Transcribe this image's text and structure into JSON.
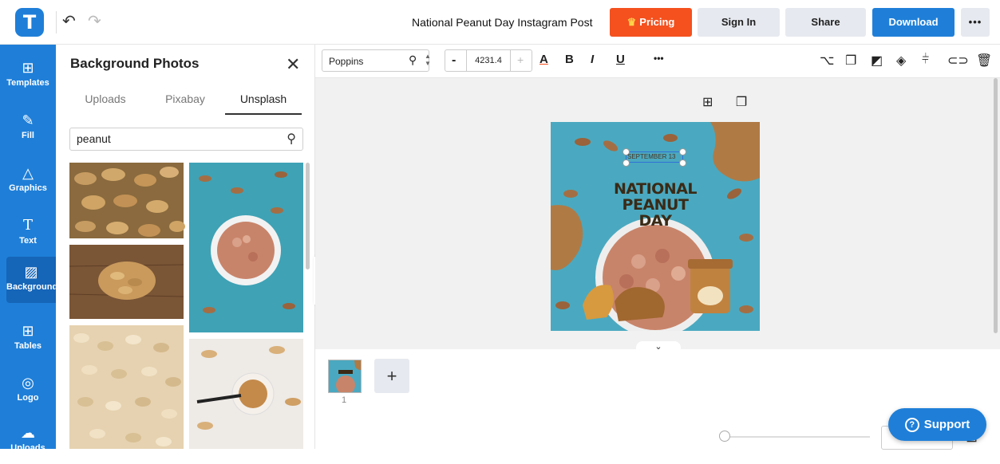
{
  "header": {
    "logo_letter": "T",
    "undo_icon": "undo-icon",
    "redo_icon": "redo-icon",
    "document_title": "National Peanut Day Instagram Post",
    "pricing_label": "Pricing",
    "signin_label": "Sign In",
    "share_label": "Share",
    "download_label": "Download",
    "more_label": "•••",
    "colors": {
      "brand": "#1f7fd8",
      "pricing": "#f4511e",
      "neutral_button": "#e6e9ef"
    }
  },
  "rail": {
    "items": [
      {
        "label": "Templates",
        "icon": "templates-icon"
      },
      {
        "label": "Fill",
        "icon": "fill-icon"
      },
      {
        "label": "Graphics",
        "icon": "graphics-icon"
      },
      {
        "label": "Text",
        "icon": "text-icon"
      },
      {
        "label": "Background",
        "icon": "background-icon"
      },
      {
        "label": "Tables",
        "icon": "tables-icon"
      },
      {
        "label": "Logo",
        "icon": "logo-icon"
      },
      {
        "label": "Uploads",
        "icon": "uploads-icon"
      }
    ],
    "active": "Background"
  },
  "panel": {
    "title": "Background Photos",
    "tabs": [
      "Uploads",
      "Pixabay",
      "Unsplash"
    ],
    "active_tab": "Unsplash",
    "search": {
      "value": "peanut",
      "placeholder": ""
    }
  },
  "toolbar": {
    "font_name": "Poppins",
    "font_size": "4231.4",
    "minus_label": "-",
    "plus_label": "+",
    "color_label": "A",
    "bold_label": "B",
    "italic_label": "I",
    "underline_label": "U",
    "more_label": "•••"
  },
  "artboard": {
    "date_text": "SEPTEMBER 13",
    "title_lines": [
      "NATIONAL",
      "PEANUT",
      "DAY"
    ],
    "colors": {
      "background": "#4aa9c0",
      "accent": "#b07a45"
    }
  },
  "pages": {
    "current_page": "1",
    "add_label": "+"
  },
  "support": {
    "label": "Support"
  }
}
